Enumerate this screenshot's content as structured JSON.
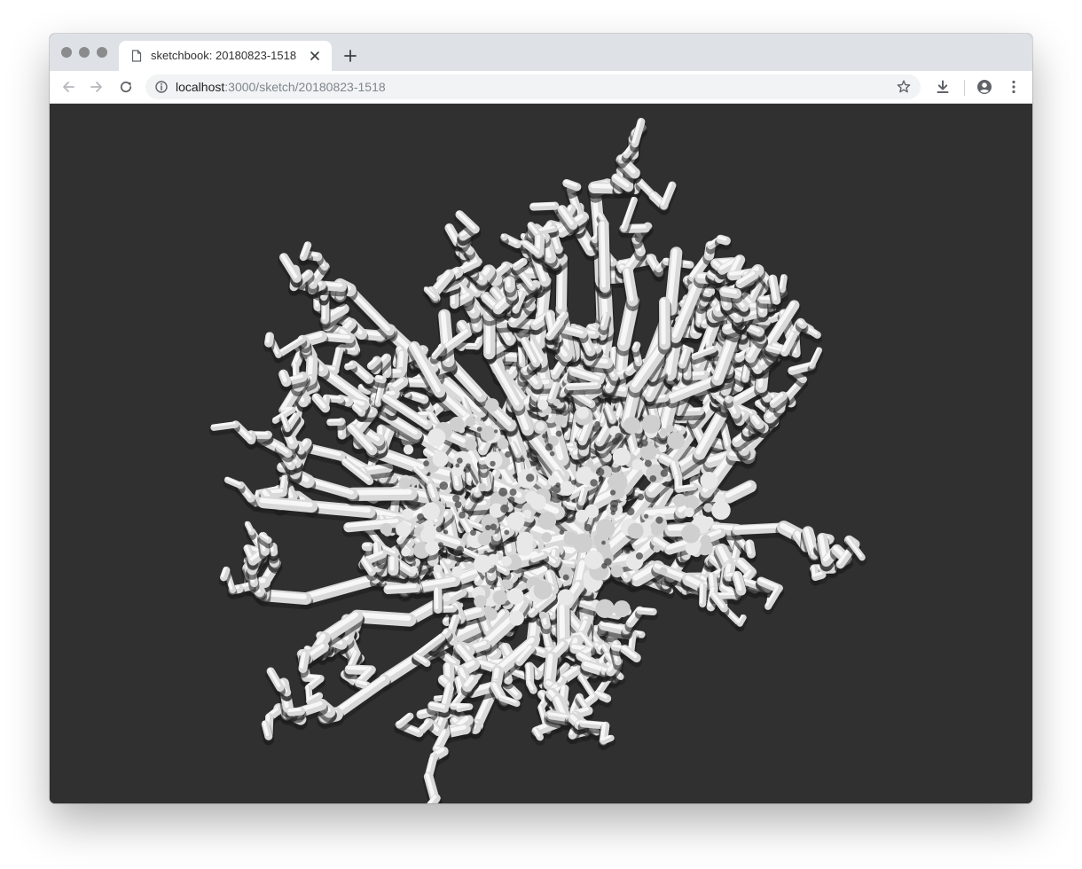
{
  "window": {
    "tab": {
      "title": "sketchbook: 20180823-1518"
    },
    "address_bar": {
      "host": "localhost",
      "path": ":3000/sketch/20180823-1518"
    }
  },
  "icons": {
    "tab": "document-icon",
    "tab_close": "close-icon",
    "new_tab": "plus-icon",
    "back": "arrow-left-icon",
    "forward": "arrow-right-icon",
    "reload": "reload-icon",
    "site_info": "info-icon",
    "bookmark": "star-icon",
    "download": "download-icon",
    "profile": "account-icon",
    "menu": "kebab-menu-icon"
  },
  "colors": {
    "tabstrip": "#dee1e6",
    "canvas_background": "#303030",
    "coral": "#e6e6e6"
  }
}
